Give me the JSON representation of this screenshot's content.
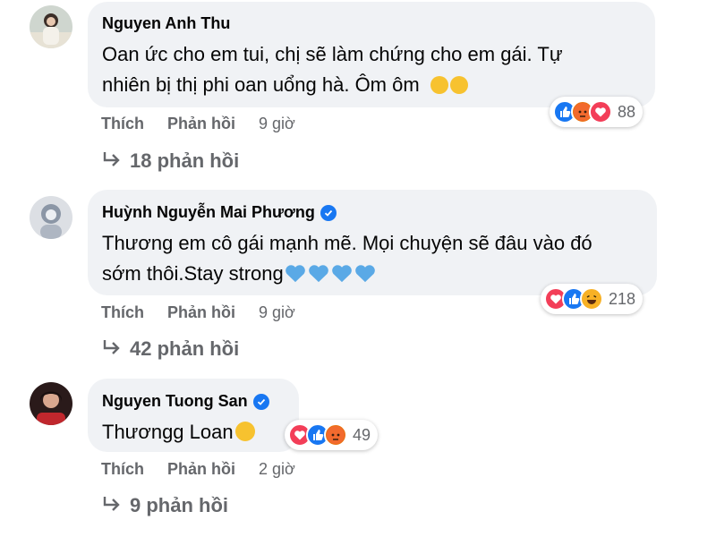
{
  "comments": [
    {
      "author": "Nguyen Anh Thu",
      "verified": false,
      "text_lines": [
        "Oan ức cho em tui, chị sẽ làm chứng cho em gái. Tự",
        "nhiên bị thị phi oan uổng hà. Ôm ôm"
      ],
      "text_emojis": [
        "hug-emoji",
        "hug-emoji"
      ],
      "reactions": [
        "like",
        "angry",
        "love"
      ],
      "reaction_count": "88",
      "like_label": "Thích",
      "reply_label": "Phản hồi",
      "time": "9 giờ",
      "replies_label": "18 phản hồi"
    },
    {
      "author": "Huỳnh Nguyễn Mai Phương",
      "verified": true,
      "text_lines": [
        "Thương em cô gái mạnh mẽ. Mọi chuyện sẽ đâu vào đó",
        "sớm thôi.Stay strong"
      ],
      "text_emojis": [
        "blue-heart",
        "blue-heart",
        "blue-heart",
        "blue-heart"
      ],
      "reactions": [
        "love",
        "like",
        "haha"
      ],
      "reaction_count": "218",
      "like_label": "Thích",
      "reply_label": "Phản hồi",
      "time": "9 giờ",
      "replies_label": "42 phản hồi"
    },
    {
      "author": "Nguyen Tuong San",
      "verified": true,
      "text_lines": [
        "Thươngg Loan"
      ],
      "text_emojis": [
        "pleading-emoji"
      ],
      "reactions": [
        "love",
        "like",
        "angry"
      ],
      "reaction_count": "49",
      "like_label": "Thích",
      "reply_label": "Phản hồi",
      "time": "2 giờ",
      "replies_label": "9 phản hồi"
    }
  ],
  "colors": {
    "bubble": "#f0f2f5",
    "secondary_text": "#65676b",
    "like_blue": "#1877f2",
    "love_red": "#f33e58",
    "angry_orange": "#e9710f",
    "haha_yellow": "#f7b125"
  }
}
